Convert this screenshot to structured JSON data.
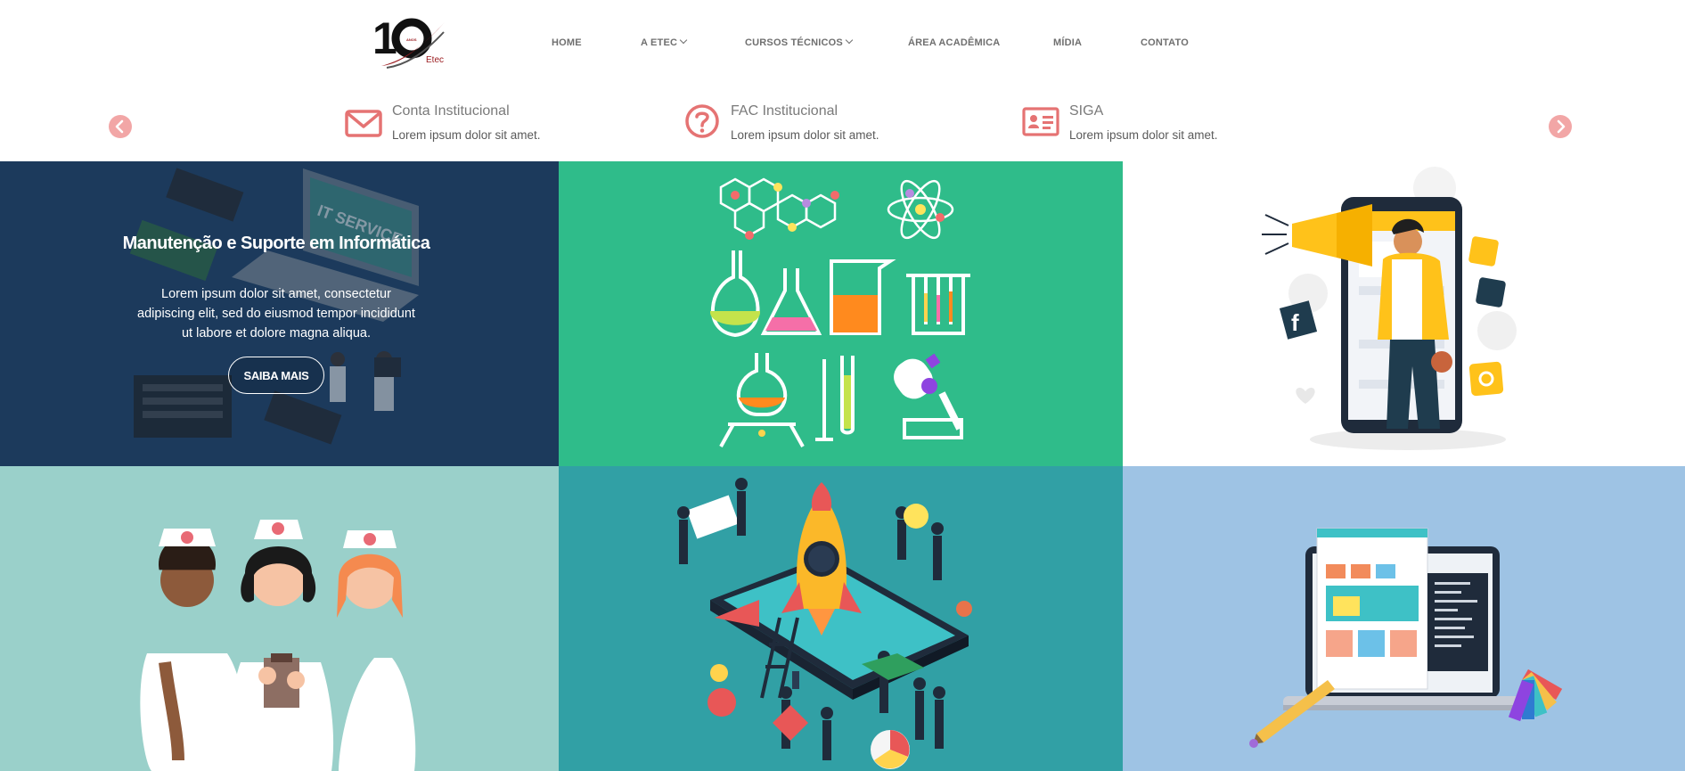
{
  "logo": {
    "number": "10",
    "small": "ANOS",
    "brand": "Etec"
  },
  "nav": {
    "items": [
      {
        "label": "HOME",
        "dropdown": false
      },
      {
        "label": "A ETEC",
        "dropdown": true
      },
      {
        "label": "CURSOS TÉCNICOS",
        "dropdown": true
      },
      {
        "label": "ÁREA ACADÊMICA",
        "dropdown": false
      },
      {
        "label": "MÍDIA",
        "dropdown": false
      },
      {
        "label": "CONTATO",
        "dropdown": false
      }
    ]
  },
  "services": {
    "accent": "#e57373",
    "items": [
      {
        "icon": "envelope-icon",
        "title": "Conta Institucional",
        "desc": "Lorem ipsum dolor sit amet."
      },
      {
        "icon": "question-circle-icon",
        "title": "FAC Institucional",
        "desc": "Lorem ipsum dolor sit amet."
      },
      {
        "icon": "id-card-icon",
        "title": "SIGA",
        "desc": "Lorem ipsum dolor sit amet."
      }
    ]
  },
  "courses": {
    "featured": {
      "title": "Manutenção e Suporte em Informática",
      "desc": "Lorem ipsum dolor sit amet, consectetur adipiscing elit, sed do eiusmod tempor incididunt ut labore et dolore magna aliqua.",
      "button": "SAIBA MAIS"
    },
    "tile_colors": {
      "it": "#1c3a5c",
      "chem": "#2fbc8a",
      "marketing": "#ffffff",
      "nursing": "#9ad0ca",
      "admin": "#31a0a5",
      "web": "#9ec3e4"
    }
  }
}
